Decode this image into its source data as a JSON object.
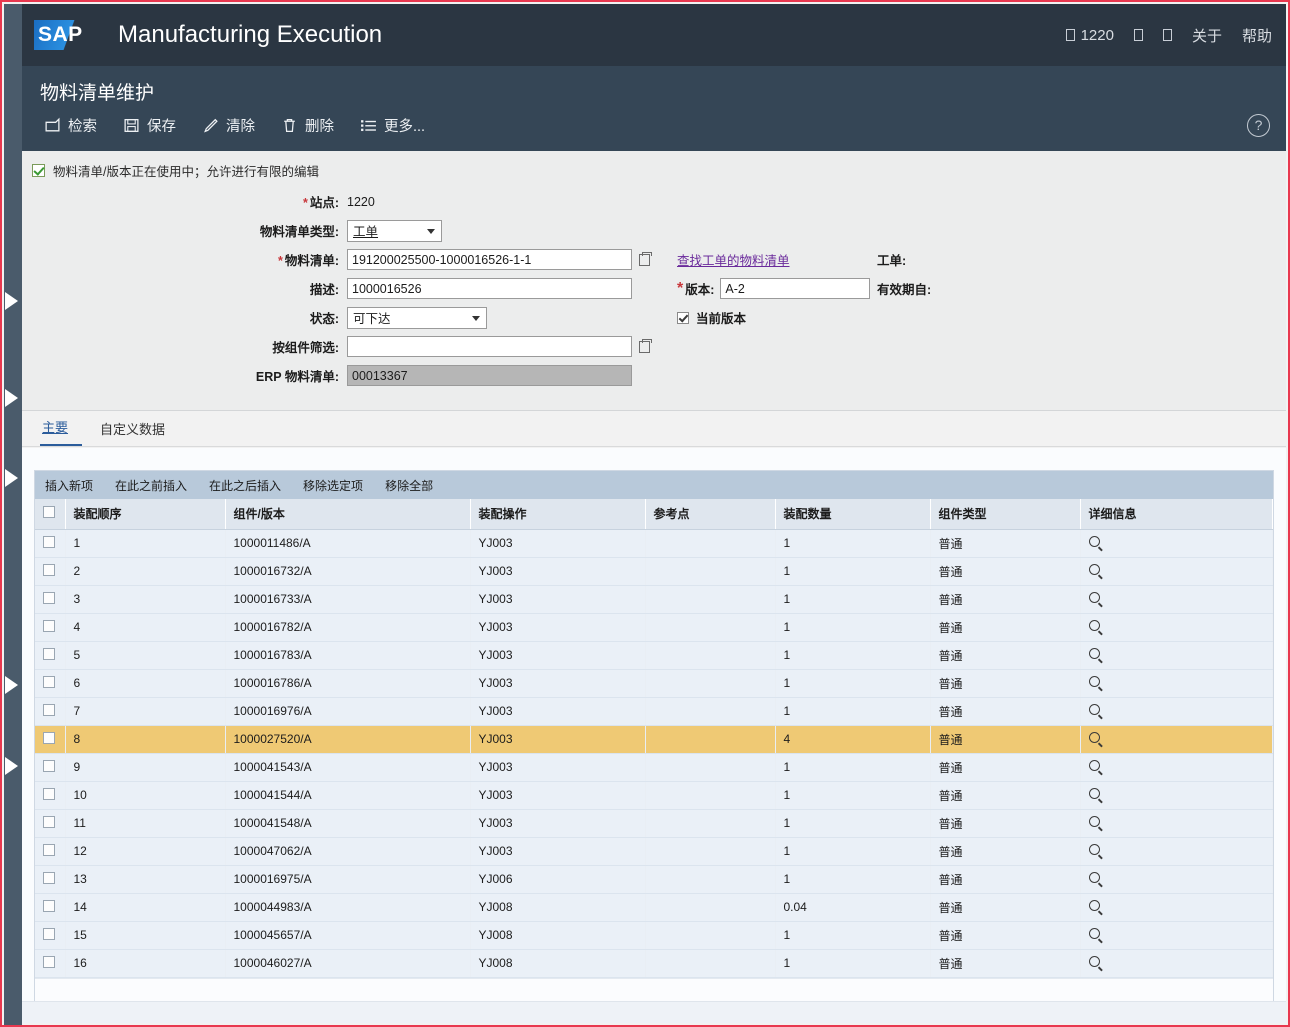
{
  "header": {
    "logo_text": "SAP",
    "app_title": "Manufacturing Execution",
    "right_items": [
      {
        "icon": "box-glyph-icon",
        "label": "1220"
      },
      {
        "icon": "box-glyph-icon",
        "label": ""
      },
      {
        "icon": "box-glyph-icon",
        "label": ""
      },
      {
        "icon": "",
        "label": "关于"
      },
      {
        "icon": "",
        "label": "帮助"
      }
    ]
  },
  "page": {
    "title": "物料清单维护",
    "help_icon": "question-mark-icon",
    "toolbar": [
      {
        "icon": "retrieve-icon",
        "label": "检索"
      },
      {
        "icon": "save-icon",
        "label": "保存"
      },
      {
        "icon": "clear-pencil-icon",
        "label": "清除"
      },
      {
        "icon": "trash-icon",
        "label": "删除"
      },
      {
        "icon": "list-more-icon",
        "label": "更多..."
      }
    ]
  },
  "form": {
    "usage_note": "物料清单/版本正在使用中；允许进行有限的编辑",
    "usage_checked": true,
    "site_label": "站点:",
    "site_value": "1220",
    "bom_type_label": "物料清单类型:",
    "bom_type_value": "工单",
    "bom_label": "物料清单:",
    "bom_value": "191200025500-1000016526-1-1",
    "desc_label": "描述:",
    "desc_value": "1000016526",
    "status_label": "状态:",
    "status_value": "可下达",
    "filter_label": "按组件筛选:",
    "filter_value": "",
    "erp_bom_label": "ERP 物料清单:",
    "erp_bom_value": "00013367",
    "find_bom_link": "查找工单的物料清单",
    "version_label": "版本:",
    "version_value": "A-2",
    "current_version_label": "当前版本",
    "current_version_checked": true,
    "work_order_label": "工单:",
    "work_order_value": "",
    "valid_from_label": "有效期自:",
    "valid_from_value": ""
  },
  "tabs": [
    {
      "label": "主要",
      "active": true
    },
    {
      "label": "自定义数据",
      "active": false
    }
  ],
  "grid": {
    "toolbar": [
      "插入新项",
      "在此之前插入",
      "在此之后插入",
      "移除选定项",
      "移除全部"
    ],
    "columns": [
      "",
      "装配顺序",
      "组件/版本",
      "装配操作",
      "参考点",
      "装配数量",
      "组件类型",
      "详细信息"
    ],
    "rows": [
      {
        "seq": "1",
        "component": "1000011486/A",
        "operation": "YJ003",
        "refpoint": "",
        "qty": "1",
        "type": "普通",
        "selected": false
      },
      {
        "seq": "2",
        "component": "1000016732/A",
        "operation": "YJ003",
        "refpoint": "",
        "qty": "1",
        "type": "普通",
        "selected": false
      },
      {
        "seq": "3",
        "component": "1000016733/A",
        "operation": "YJ003",
        "refpoint": "",
        "qty": "1",
        "type": "普通",
        "selected": false
      },
      {
        "seq": "4",
        "component": "1000016782/A",
        "operation": "YJ003",
        "refpoint": "",
        "qty": "1",
        "type": "普通",
        "selected": false
      },
      {
        "seq": "5",
        "component": "1000016783/A",
        "operation": "YJ003",
        "refpoint": "",
        "qty": "1",
        "type": "普通",
        "selected": false
      },
      {
        "seq": "6",
        "component": "1000016786/A",
        "operation": "YJ003",
        "refpoint": "",
        "qty": "1",
        "type": "普通",
        "selected": false
      },
      {
        "seq": "7",
        "component": "1000016976/A",
        "operation": "YJ003",
        "refpoint": "",
        "qty": "1",
        "type": "普通",
        "selected": false
      },
      {
        "seq": "8",
        "component": "1000027520/A",
        "operation": "YJ003",
        "refpoint": "",
        "qty": "4",
        "type": "普通",
        "selected": true
      },
      {
        "seq": "9",
        "component": "1000041543/A",
        "operation": "YJ003",
        "refpoint": "",
        "qty": "1",
        "type": "普通",
        "selected": false
      },
      {
        "seq": "10",
        "component": "1000041544/A",
        "operation": "YJ003",
        "refpoint": "",
        "qty": "1",
        "type": "普通",
        "selected": false
      },
      {
        "seq": "11",
        "component": "1000041548/A",
        "operation": "YJ003",
        "refpoint": "",
        "qty": "1",
        "type": "普通",
        "selected": false
      },
      {
        "seq": "12",
        "component": "1000047062/A",
        "operation": "YJ003",
        "refpoint": "",
        "qty": "1",
        "type": "普通",
        "selected": false
      },
      {
        "seq": "13",
        "component": "1000016975/A",
        "operation": "YJ006",
        "refpoint": "",
        "qty": "1",
        "type": "普通",
        "selected": false
      },
      {
        "seq": "14",
        "component": "1000044983/A",
        "operation": "YJ008",
        "refpoint": "",
        "qty": "0.04",
        "type": "普通",
        "selected": false
      },
      {
        "seq": "15",
        "component": "1000045657/A",
        "operation": "YJ008",
        "refpoint": "",
        "qty": "1",
        "type": "普通",
        "selected": false
      },
      {
        "seq": "16",
        "component": "1000046027/A",
        "operation": "YJ008",
        "refpoint": "",
        "qty": "1",
        "type": "普通",
        "selected": false
      }
    ]
  },
  "colors": {
    "shell_header": "#2b3642",
    "page_bar": "#354656",
    "left_rail": "#4a5b6b",
    "page_border": "#e8384f",
    "selected_row": "#efc974",
    "link": "#6a2a9b",
    "required": "#c8373b"
  }
}
